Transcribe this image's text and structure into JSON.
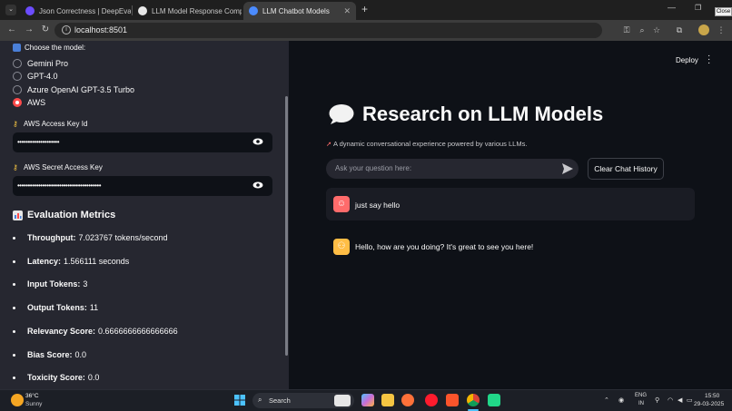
{
  "browser": {
    "tabs": [
      {
        "label": "Json Correctness | DeepEval - T",
        "favicon_color": "#6b4cff"
      },
      {
        "label": "LLM Model Response Comparis",
        "favicon_color": "#e8e8e8"
      },
      {
        "label": "LLM Chatbot Models",
        "favicon_color": "#4b8bff"
      }
    ],
    "url": "localhost:8501",
    "close_tooltip": "Close"
  },
  "sidebar": {
    "model_label": "Choose the model:",
    "models": [
      "Gemini Pro",
      "GPT-4.0",
      "Azure OpenAI GPT-3.5 Turbo",
      "AWS"
    ],
    "selected_model": "AWS",
    "access_key_label": "AWS Access Key Id",
    "access_key_value": "••••••••••••••••••••",
    "secret_key_label": "AWS Secret Access Key",
    "secret_key_value": "••••••••••••••••••••••••••••••••••••••••",
    "metrics_title": "Evaluation Metrics",
    "metrics": [
      {
        "label": "Throughput:",
        "value": "7.023767 tokens/second"
      },
      {
        "label": "Latency:",
        "value": "1.566111 seconds"
      },
      {
        "label": "Input Tokens:",
        "value": "3"
      },
      {
        "label": "Output Tokens:",
        "value": "11"
      },
      {
        "label": "Relevancy Score:",
        "value": "0.6666666666666666"
      },
      {
        "label": "Bias Score:",
        "value": "0.0"
      },
      {
        "label": "Toxicity Score:",
        "value": "0.0"
      }
    ]
  },
  "main": {
    "deploy_label": "Deploy",
    "title": "Research on LLM Models",
    "subtitle": "A dynamic conversational experience powered by various LLMs.",
    "chat_placeholder": "Ask your question here:",
    "clear_button": "Clear Chat History",
    "messages": [
      {
        "role": "user",
        "text": "just say hello"
      },
      {
        "role": "assistant",
        "text": "Hello, how are you doing? It's great to see you here!"
      }
    ]
  },
  "taskbar": {
    "temperature": "36°C",
    "weather": "Sunny",
    "search_label": "Search",
    "lang_top": "ENG",
    "lang_bottom": "IN",
    "time": "15:50",
    "date": "29-03-2025"
  },
  "colors": {
    "accent": "#ff4b4b",
    "sidebar_bg": "#262730",
    "main_bg": "#0e1117"
  }
}
